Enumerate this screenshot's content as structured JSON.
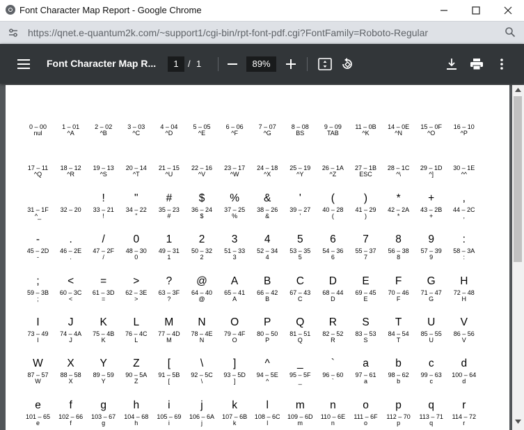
{
  "window": {
    "title": "Font Character Map Report - Google Chrome"
  },
  "address": {
    "url": "https://qnet.e-quantum2k.com/~support1/cgi-bin/rpt-font-pdf.cgi?FontFamily=Roboto-Regular"
  },
  "pdf_toolbar": {
    "title": "Font Character Map R...",
    "page_current": "1",
    "page_separator": "/",
    "page_total": "1",
    "zoom": "89%"
  },
  "char_rows": [
    [
      {
        "g": "",
        "c": "0 – 00",
        "s": "nul"
      },
      {
        "g": "",
        "c": "1 – 01",
        "s": "^A"
      },
      {
        "g": "",
        "c": "2 – 02",
        "s": "^B"
      },
      {
        "g": "",
        "c": "3 – 03",
        "s": "^C"
      },
      {
        "g": "",
        "c": "4 – 04",
        "s": "^D"
      },
      {
        "g": "",
        "c": "5 – 05",
        "s": "^E"
      },
      {
        "g": "",
        "c": "6 – 06",
        "s": "^F"
      },
      {
        "g": "",
        "c": "7 – 07",
        "s": "^G"
      },
      {
        "g": "",
        "c": "8 – 08",
        "s": "BS"
      },
      {
        "g": "",
        "c": "9 – 09",
        "s": "TAB"
      },
      {
        "g": "",
        "c": "11 – 0B",
        "s": "^K"
      },
      {
        "g": "",
        "c": "14 – 0E",
        "s": "^N"
      },
      {
        "g": "",
        "c": "15 – 0F",
        "s": "^O"
      },
      {
        "g": "",
        "c": "16 – 10",
        "s": "^P"
      }
    ],
    [
      {
        "g": "",
        "c": "17 – 11",
        "s": "^Q"
      },
      {
        "g": "",
        "c": "18 – 12",
        "s": "^R"
      },
      {
        "g": "",
        "c": "19 – 13",
        "s": "^S"
      },
      {
        "g": "",
        "c": "20 – 14",
        "s": "^T"
      },
      {
        "g": "",
        "c": "21 – 15",
        "s": "^U"
      },
      {
        "g": "",
        "c": "22 – 16",
        "s": "^V"
      },
      {
        "g": "",
        "c": "23 – 17",
        "s": "^W"
      },
      {
        "g": "",
        "c": "24 – 18",
        "s": "^X"
      },
      {
        "g": "",
        "c": "25 – 19",
        "s": "^Y"
      },
      {
        "g": "",
        "c": "26 – 1A",
        "s": "^Z"
      },
      {
        "g": "",
        "c": "27 – 1B",
        "s": "ESC"
      },
      {
        "g": "",
        "c": "28 – 1C",
        "s": "^\\"
      },
      {
        "g": "",
        "c": "29 – 1D",
        "s": "^]"
      },
      {
        "g": "",
        "c": "30 – 1E",
        "s": "^^"
      }
    ],
    [
      {
        "g": "",
        "c": "31 – 1F",
        "s": "^_"
      },
      {
        "g": "",
        "c": "32 – 20",
        "s": ""
      },
      {
        "g": "!",
        "c": "33 – 21",
        "s": "!"
      },
      {
        "g": "\"",
        "c": "34 – 22",
        "s": "\""
      },
      {
        "g": "#",
        "c": "35 – 23",
        "s": "#"
      },
      {
        "g": "$",
        "c": "36 – 24",
        "s": "$"
      },
      {
        "g": "%",
        "c": "37 – 25",
        "s": "%"
      },
      {
        "g": "&",
        "c": "38 – 26",
        "s": "&"
      },
      {
        "g": "'",
        "c": "39 – 27",
        "s": "'"
      },
      {
        "g": "(",
        "c": "40 – 28",
        "s": "("
      },
      {
        "g": ")",
        "c": "41 – 29",
        "s": ")"
      },
      {
        "g": "*",
        "c": "42 – 2A",
        "s": "*"
      },
      {
        "g": "+",
        "c": "43 – 2B",
        "s": "+"
      },
      {
        "g": ",",
        "c": "44 – 2C",
        "s": ","
      }
    ],
    [
      {
        "g": "-",
        "c": "45 – 2D",
        "s": "-"
      },
      {
        "g": ".",
        "c": "46 – 2E",
        "s": "."
      },
      {
        "g": "/",
        "c": "47 – 2F",
        "s": "/"
      },
      {
        "g": "0",
        "c": "48 – 30",
        "s": "0"
      },
      {
        "g": "1",
        "c": "49 – 31",
        "s": "1"
      },
      {
        "g": "2",
        "c": "50 – 32",
        "s": "2"
      },
      {
        "g": "3",
        "c": "51 – 33",
        "s": "3"
      },
      {
        "g": "4",
        "c": "52 – 34",
        "s": "4"
      },
      {
        "g": "5",
        "c": "53 – 35",
        "s": "5"
      },
      {
        "g": "6",
        "c": "54 – 36",
        "s": "6"
      },
      {
        "g": "7",
        "c": "55 – 37",
        "s": "7"
      },
      {
        "g": "8",
        "c": "56 – 38",
        "s": "8"
      },
      {
        "g": "9",
        "c": "57 – 39",
        "s": "9"
      },
      {
        "g": ":",
        "c": "58 – 3A",
        "s": ":"
      }
    ],
    [
      {
        "g": ";",
        "c": "59 – 3B",
        "s": ";"
      },
      {
        "g": "<",
        "c": "60 – 3C",
        "s": "<"
      },
      {
        "g": "=",
        "c": "61 – 3D",
        "s": "="
      },
      {
        "g": ">",
        "c": "62 – 3E",
        "s": ">"
      },
      {
        "g": "?",
        "c": "63 – 3F",
        "s": "?"
      },
      {
        "g": "@",
        "c": "64 – 40",
        "s": "@"
      },
      {
        "g": "A",
        "c": "65 – 41",
        "s": "A"
      },
      {
        "g": "B",
        "c": "66 – 42",
        "s": "B"
      },
      {
        "g": "C",
        "c": "67 – 43",
        "s": "C"
      },
      {
        "g": "D",
        "c": "68 – 44",
        "s": "D"
      },
      {
        "g": "E",
        "c": "69 – 45",
        "s": "E"
      },
      {
        "g": "F",
        "c": "70 – 46",
        "s": "F"
      },
      {
        "g": "G",
        "c": "71 – 47",
        "s": "G"
      },
      {
        "g": "H",
        "c": "72 – 48",
        "s": "H"
      }
    ],
    [
      {
        "g": "I",
        "c": "73 – 49",
        "s": "I"
      },
      {
        "g": "J",
        "c": "74 – 4A",
        "s": "J"
      },
      {
        "g": "K",
        "c": "75 – 4B",
        "s": "K"
      },
      {
        "g": "L",
        "c": "76 – 4C",
        "s": "L"
      },
      {
        "g": "M",
        "c": "77 – 4D",
        "s": "M"
      },
      {
        "g": "N",
        "c": "78 – 4E",
        "s": "N"
      },
      {
        "g": "O",
        "c": "79 – 4F",
        "s": "O"
      },
      {
        "g": "P",
        "c": "80 – 50",
        "s": "P"
      },
      {
        "g": "Q",
        "c": "81 – 51",
        "s": "Q"
      },
      {
        "g": "R",
        "c": "82 – 52",
        "s": "R"
      },
      {
        "g": "S",
        "c": "83 – 53",
        "s": "S"
      },
      {
        "g": "T",
        "c": "84 – 54",
        "s": "T"
      },
      {
        "g": "U",
        "c": "85 – 55",
        "s": "U"
      },
      {
        "g": "V",
        "c": "86 – 56",
        "s": "V"
      }
    ],
    [
      {
        "g": "W",
        "c": "87 – 57",
        "s": "W"
      },
      {
        "g": "X",
        "c": "88 – 58",
        "s": "X"
      },
      {
        "g": "Y",
        "c": "89 – 59",
        "s": "Y"
      },
      {
        "g": "Z",
        "c": "90 – 5A",
        "s": "Z"
      },
      {
        "g": "[",
        "c": "91 – 5B",
        "s": "["
      },
      {
        "g": "\\",
        "c": "92 – 5C",
        "s": "\\"
      },
      {
        "g": "]",
        "c": "93 – 5D",
        "s": "]"
      },
      {
        "g": "^",
        "c": "94 – 5E",
        "s": "^"
      },
      {
        "g": "_",
        "c": "95 – 5F",
        "s": "_"
      },
      {
        "g": "`",
        "c": "96 – 60",
        "s": "`"
      },
      {
        "g": "a",
        "c": "97 – 61",
        "s": "a"
      },
      {
        "g": "b",
        "c": "98 – 62",
        "s": "b"
      },
      {
        "g": "c",
        "c": "99 – 63",
        "s": "c"
      },
      {
        "g": "d",
        "c": "100 – 64",
        "s": "d"
      }
    ],
    [
      {
        "g": "e",
        "c": "101 – 65",
        "s": "e"
      },
      {
        "g": "f",
        "c": "102 – 66",
        "s": "f"
      },
      {
        "g": "g",
        "c": "103 – 67",
        "s": "g"
      },
      {
        "g": "h",
        "c": "104 – 68",
        "s": "h"
      },
      {
        "g": "i",
        "c": "105 – 69",
        "s": "i"
      },
      {
        "g": "j",
        "c": "106 – 6A",
        "s": "j"
      },
      {
        "g": "k",
        "c": "107 – 6B",
        "s": "k"
      },
      {
        "g": "l",
        "c": "108 – 6C",
        "s": "l"
      },
      {
        "g": "m",
        "c": "109 – 6D",
        "s": "m"
      },
      {
        "g": "n",
        "c": "110 – 6E",
        "s": "n"
      },
      {
        "g": "o",
        "c": "111 – 6F",
        "s": "o"
      },
      {
        "g": "p",
        "c": "112 – 70",
        "s": "p"
      },
      {
        "g": "q",
        "c": "113 – 71",
        "s": "q"
      },
      {
        "g": "r",
        "c": "114 – 72",
        "s": "r"
      }
    ]
  ],
  "colors": {
    "pdf_toolbar_bg": "#323639",
    "viewer_bg": "#525659",
    "address_bar_bg": "#dee1e6"
  },
  "icons": {
    "chrome": "chrome-logo-icon",
    "site_info": "tune-icon",
    "zoom": "magnifier-icon",
    "menu": "hamburger-menu-icon",
    "zoom_out": "minus-icon",
    "zoom_in": "plus-icon",
    "fit": "fit-to-page-icon",
    "rotate": "rotate-icon",
    "download": "download-icon",
    "print": "print-icon",
    "more": "more-vert-icon"
  }
}
